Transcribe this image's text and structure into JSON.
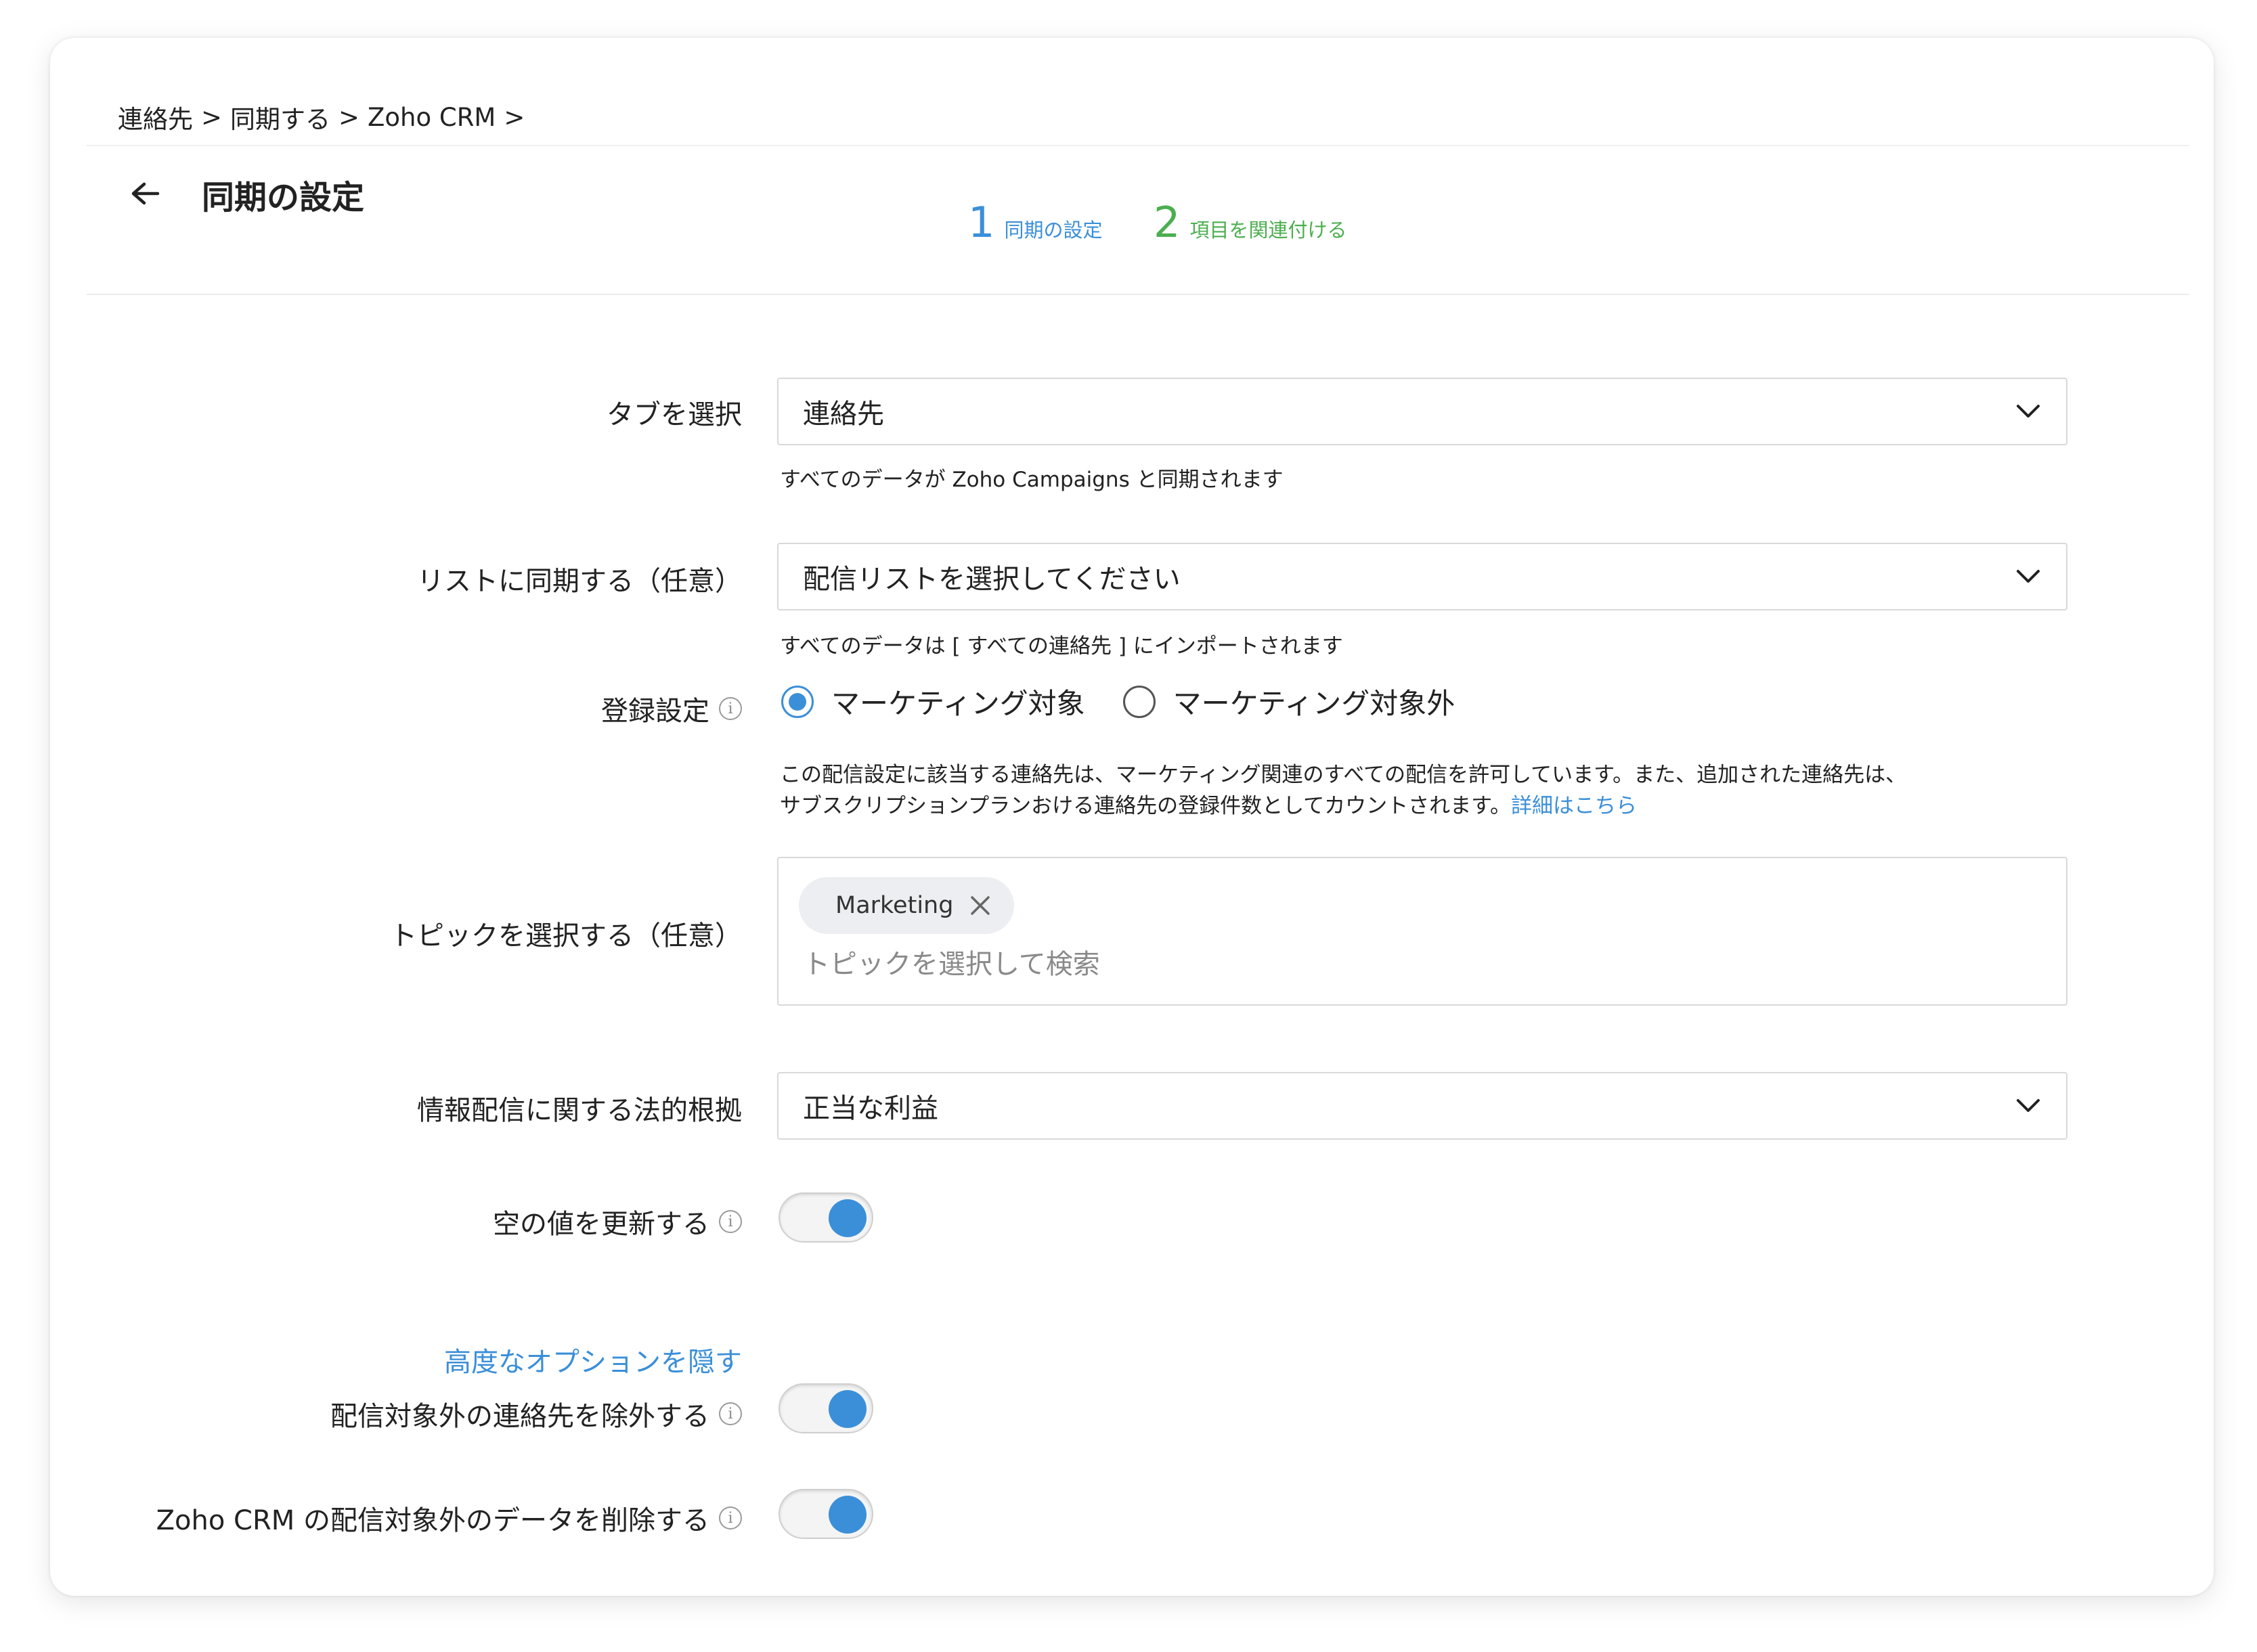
{
  "breadcrumb": {
    "items": [
      "連絡先",
      "同期する",
      "Zoho CRM"
    ],
    "separator": ">"
  },
  "header": {
    "title": "同期の設定",
    "steps": [
      {
        "num": "1",
        "label": "同期の設定",
        "color": "#3b8fd8"
      },
      {
        "num": "2",
        "label": "項目を関連付ける",
        "color": "#4cae4f"
      }
    ]
  },
  "form": {
    "tab": {
      "label": "タブを選択",
      "value": "連絡先",
      "hint": "すべてのデータが Zoho Campaigns と同期されます"
    },
    "list": {
      "label": "リストに同期する（任意）",
      "value": "配信リストを選択してください",
      "hint": "すべてのデータは [ すべての連絡先 ] にインポートされます"
    },
    "subscription": {
      "label": "登録設定",
      "options": [
        "マーケティング対象",
        "マーケティング対象外"
      ],
      "selected": "マーケティング対象",
      "hint_line1": "この配信設定に該当する連絡先は、マーケティング関連のすべての配信を許可しています。また、追加された連絡先は、",
      "hint_line2": "サブスクリプションプランおける連絡先の登録件数としてカウントされます。",
      "hint_link": "詳細はこちら"
    },
    "topics": {
      "label": "トピックを選択する（任意）",
      "chips": [
        "Marketing"
      ],
      "placeholder": "トピックを選択して検索"
    },
    "legal_basis": {
      "label": "情報配信に関する法的根拠",
      "value": "正当な利益"
    },
    "update_empty": {
      "label": "空の値を更新する",
      "on": true
    },
    "advanced_link": "高度なオプションを隠す",
    "exclude_unsubscribed": {
      "label": "配信対象外の連絡先を除外する",
      "on": true
    },
    "delete_unsubscribed": {
      "label": "Zoho CRM の配信対象外のデータを削除する",
      "on": true
    }
  },
  "colors": {
    "accent": "#3b8fd8",
    "step2": "#4cae4f"
  }
}
